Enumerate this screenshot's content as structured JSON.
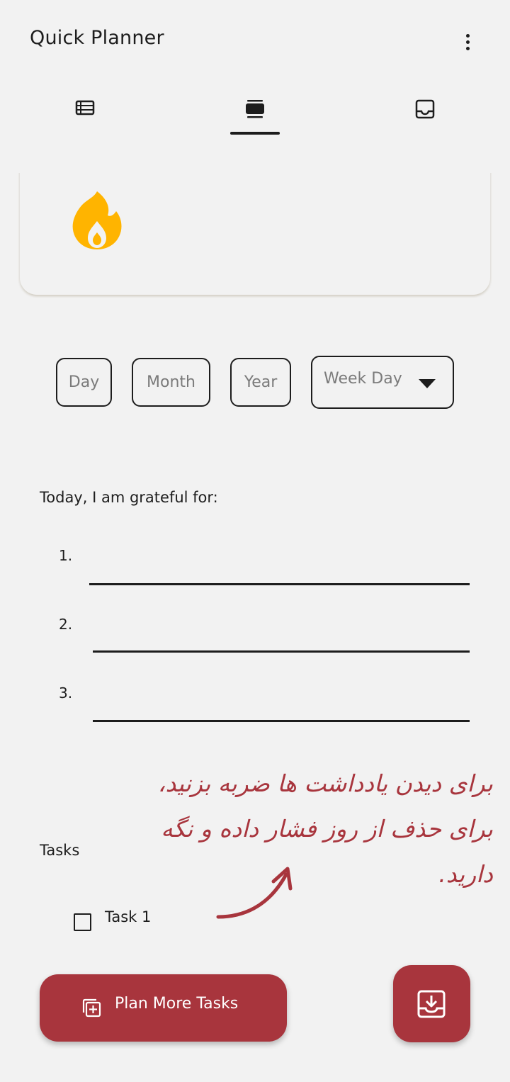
{
  "app": {
    "title": "Quick Planner"
  },
  "icons": {
    "menu": "more-vert-icon",
    "tab_list": "list-view-icon",
    "tab_card": "card-view-icon",
    "tab_inbox": "inbox-icon",
    "streak": "flame-icon",
    "plan_button": "add-to-list-icon",
    "save_button": "save-to-inbox-icon"
  },
  "colors": {
    "accent": "#A8353D",
    "flame": "#FFB400",
    "background": "#F2F2F2",
    "text": "#1D1D1D",
    "placeholder": "#7B7B7B"
  },
  "tabs": {
    "selected_index": 1
  },
  "date": {
    "day_placeholder": "Day",
    "month_placeholder": "Month",
    "year_placeholder": "Year",
    "weekday_placeholder": "Week Day"
  },
  "gratitude": {
    "heading": "Today, I am grateful for:",
    "items": [
      {
        "number": "1.",
        "value": ""
      },
      {
        "number": "2.",
        "value": ""
      },
      {
        "number": "3.",
        "value": ""
      }
    ]
  },
  "hint": {
    "line1": "برای دیدن یادداشت ها ضربه بزنید،",
    "line2": "برای حذف از روز فشار داده و نگه دارید."
  },
  "tasks": {
    "heading": "Tasks",
    "items": [
      {
        "label": "Task 1",
        "checked": false
      }
    ]
  },
  "actions": {
    "plan_more_label": "Plan More Tasks"
  }
}
